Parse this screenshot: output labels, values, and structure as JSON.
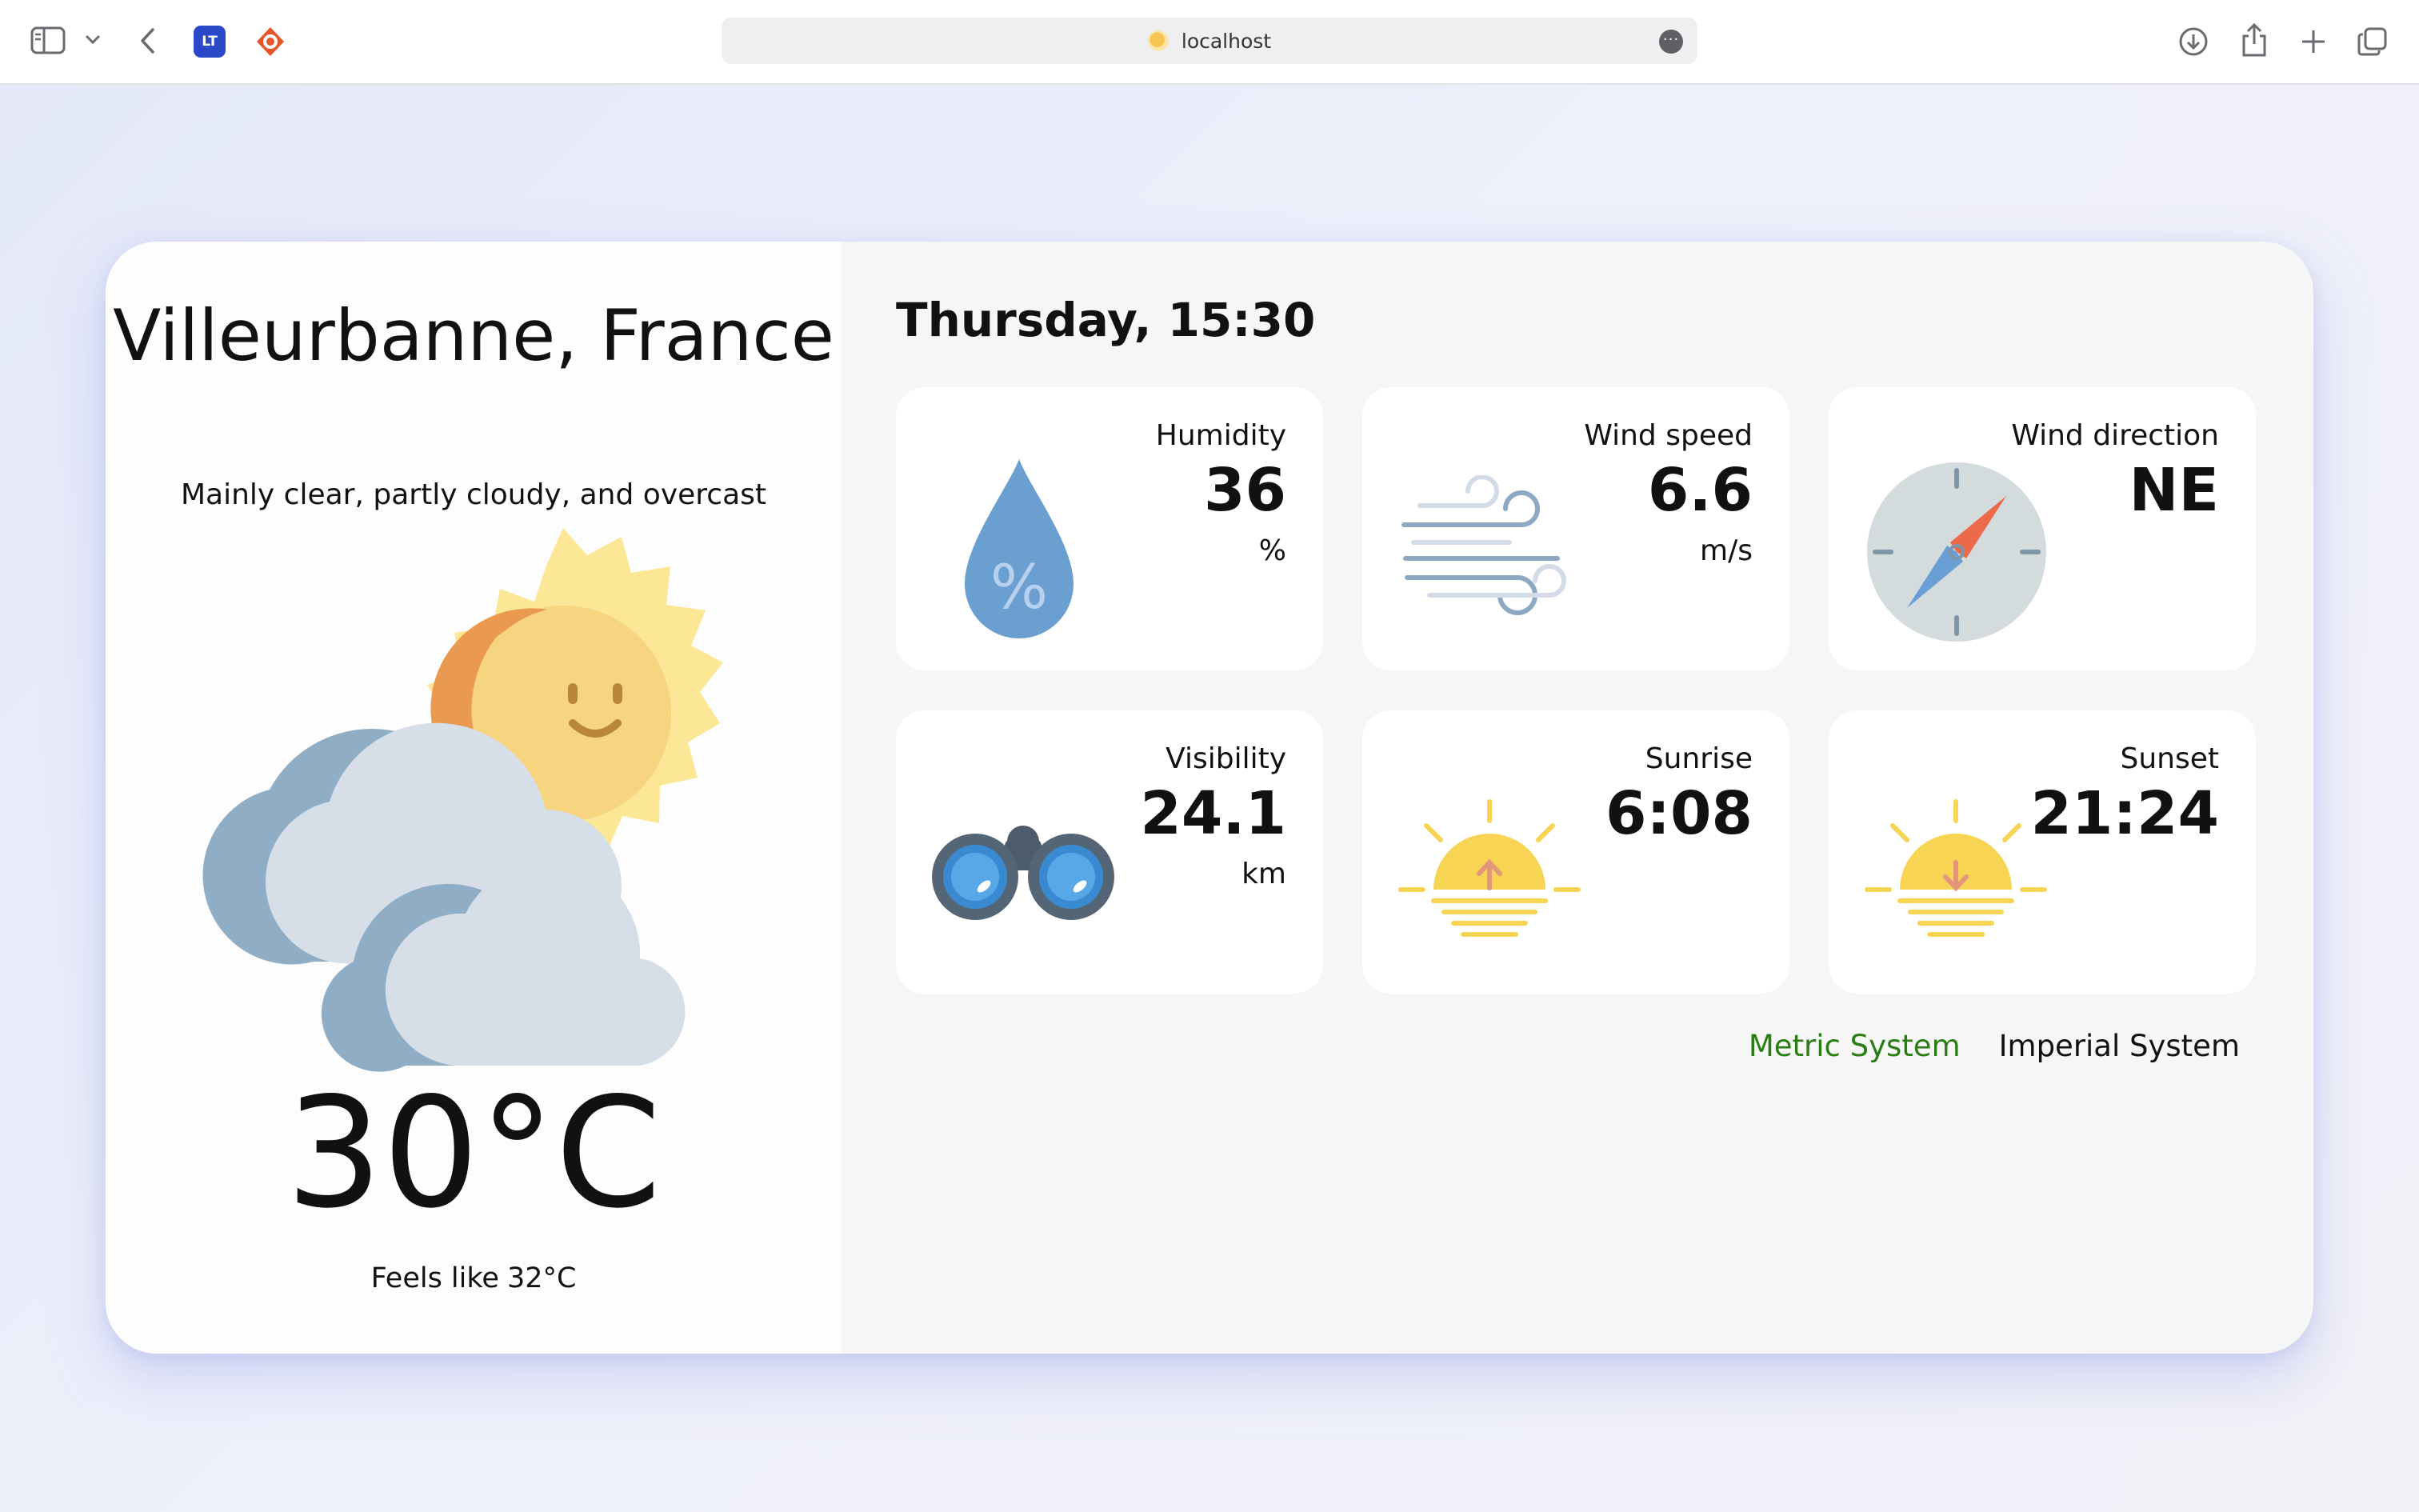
{
  "browser": {
    "address": "localhost",
    "extension_badge": "LT",
    "accent": "#2b48c8"
  },
  "weather": {
    "city": "Villeurbanne, France",
    "condition": "Mainly clear, partly cloudy, and overcast",
    "temperature": "30°C",
    "feels_like_label": "Feels like",
    "feels_like_value": "32°C"
  },
  "datetime": "Thursday, 15:30",
  "metrics": {
    "humidity": {
      "title": "Humidity",
      "value": "36",
      "unit": "%"
    },
    "wind_speed": {
      "title": "Wind speed",
      "value": "6.6",
      "unit": "m/s"
    },
    "wind_direction": {
      "title": "Wind direction",
      "value": "NE"
    },
    "visibility": {
      "title": "Visibility",
      "value": "24.1",
      "unit": "km"
    },
    "sunrise": {
      "title": "Sunrise",
      "value": "6:08"
    },
    "sunset": {
      "title": "Sunset",
      "value": "21:24"
    }
  },
  "units": {
    "metric": "Metric System",
    "imperial": "Imperial System",
    "active": "metric",
    "active_color": "#2a7d14"
  },
  "icons": [
    "sidebar-icon",
    "chevron-down-icon",
    "back-arrow-icon",
    "extension-icon",
    "share-icon",
    "download-icon",
    "new-tab-icon",
    "tabs-overview-icon",
    "more-icon",
    "water-drop-icon",
    "wind-icon",
    "compass-icon",
    "binoculars-icon",
    "sunrise-icon",
    "sunset-icon",
    "sun-cloud-icon"
  ]
}
